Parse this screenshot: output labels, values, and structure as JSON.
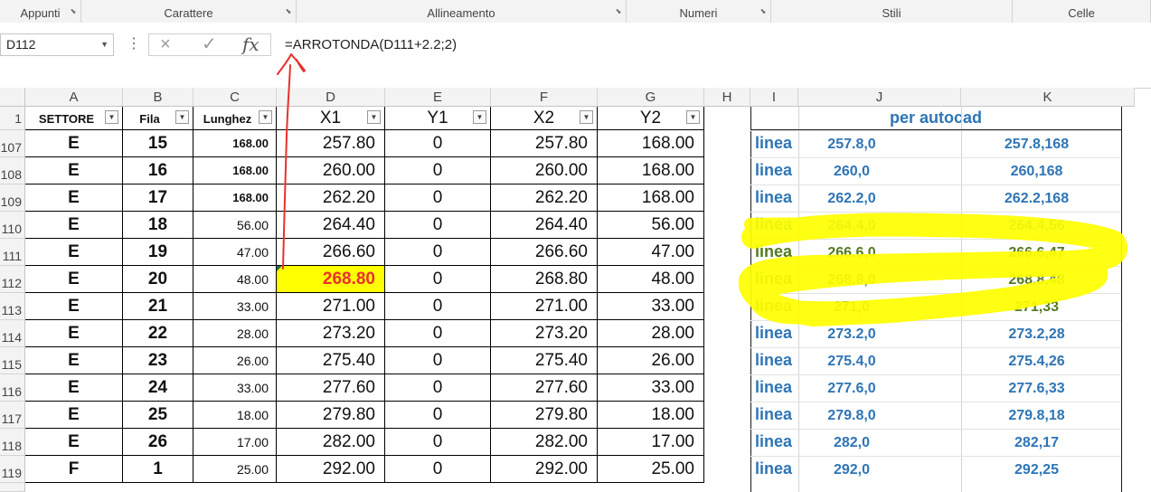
{
  "ribbon": {
    "groups": [
      "Appunti",
      "Carattere",
      "Allineamento",
      "Numeri",
      "Stili",
      "Celle"
    ]
  },
  "formula_bar": {
    "name_box": "D112",
    "formula": "=ARROTONDA(D111+2.2;2)",
    "cancel_icon": "×",
    "enter_icon": "✓",
    "fx_label": "fx"
  },
  "columns": [
    "A",
    "B",
    "C",
    "D",
    "E",
    "F",
    "G",
    "H",
    "I",
    "J",
    "K"
  ],
  "header_row": {
    "row_number": "1",
    "A": "SETTORE",
    "B": "Fila",
    "C": "Lunghez",
    "D": "X1",
    "E": "Y1",
    "F": "X2",
    "G": "Y2",
    "J": "per autocad"
  },
  "rows": [
    {
      "n": "107",
      "A": "E",
      "B": "15",
      "C": "168.00",
      "D": "257.80",
      "E": "0",
      "F": "257.80",
      "G": "168.00",
      "I": "linea",
      "J": "257.8,0",
      "K": "257.8,168"
    },
    {
      "n": "108",
      "A": "E",
      "B": "16",
      "C": "168.00",
      "D": "260.00",
      "E": "0",
      "F": "260.00",
      "G": "168.00",
      "I": "linea",
      "J": "260,0",
      "K": "260,168"
    },
    {
      "n": "109",
      "A": "E",
      "B": "17",
      "C": "168.00",
      "D": "262.20",
      "E": "0",
      "F": "262.20",
      "G": "168.00",
      "I": "linea",
      "J": "262.2,0",
      "K": "262.2,168"
    },
    {
      "n": "110",
      "A": "E",
      "B": "18",
      "C": "56.00",
      "D": "264.40",
      "E": "0",
      "F": "264.40",
      "G": "56.00",
      "I": "linea",
      "J": "264.4,0",
      "K": "264.4,56"
    },
    {
      "n": "111",
      "A": "E",
      "B": "19",
      "C": "47.00",
      "D": "266.60",
      "E": "0",
      "F": "266.60",
      "G": "47.00",
      "I": "linea",
      "J": "266.6,0",
      "K": "266.6,47"
    },
    {
      "n": "112",
      "A": "E",
      "B": "20",
      "C": "48.00",
      "D": "268.80",
      "E": "0",
      "F": "268.80",
      "G": "48.00",
      "I": "linea",
      "J": "268.8,0",
      "K": "268.8,48"
    },
    {
      "n": "113",
      "A": "E",
      "B": "21",
      "C": "33.00",
      "D": "271.00",
      "E": "0",
      "F": "271.00",
      "G": "33.00",
      "I": "linea",
      "J": "271,0",
      "K": "271,33"
    },
    {
      "n": "114",
      "A": "E",
      "B": "22",
      "C": "28.00",
      "D": "273.20",
      "E": "0",
      "F": "273.20",
      "G": "28.00",
      "I": "linea",
      "J": "273.2,0",
      "K": "273.2,28"
    },
    {
      "n": "115",
      "A": "E",
      "B": "23",
      "C": "26.00",
      "D": "275.40",
      "E": "0",
      "F": "275.40",
      "G": "26.00",
      "I": "linea",
      "J": "275.4,0",
      "K": "275.4,26"
    },
    {
      "n": "116",
      "A": "E",
      "B": "24",
      "C": "33.00",
      "D": "277.60",
      "E": "0",
      "F": "277.60",
      "G": "33.00",
      "I": "linea",
      "J": "277.6,0",
      "K": "277.6,33"
    },
    {
      "n": "117",
      "A": "E",
      "B": "25",
      "C": "18.00",
      "D": "279.80",
      "E": "0",
      "F": "279.80",
      "G": "18.00",
      "I": "linea",
      "J": "279.8,0",
      "K": "279.8,18"
    },
    {
      "n": "118",
      "A": "E",
      "B": "26",
      "C": "17.00",
      "D": "282.00",
      "E": "0",
      "F": "282.00",
      "G": "17.00",
      "I": "linea",
      "J": "282,0",
      "K": "282,17"
    },
    {
      "n": "119",
      "A": "F",
      "B": "1",
      "C": "25.00",
      "D": "292.00",
      "E": "0",
      "F": "292.00",
      "G": "25.00",
      "I": "linea",
      "J": "292,0",
      "K": "292,25"
    }
  ],
  "selected_cell": {
    "row": "112",
    "col": "D"
  },
  "colors": {
    "selected_fill": "#ffff00",
    "selected_text": "#e8312b",
    "linea_blue": "#2e75b6",
    "annotation_red": "#e8312b",
    "highlighter_yellow": "#ffff00"
  }
}
